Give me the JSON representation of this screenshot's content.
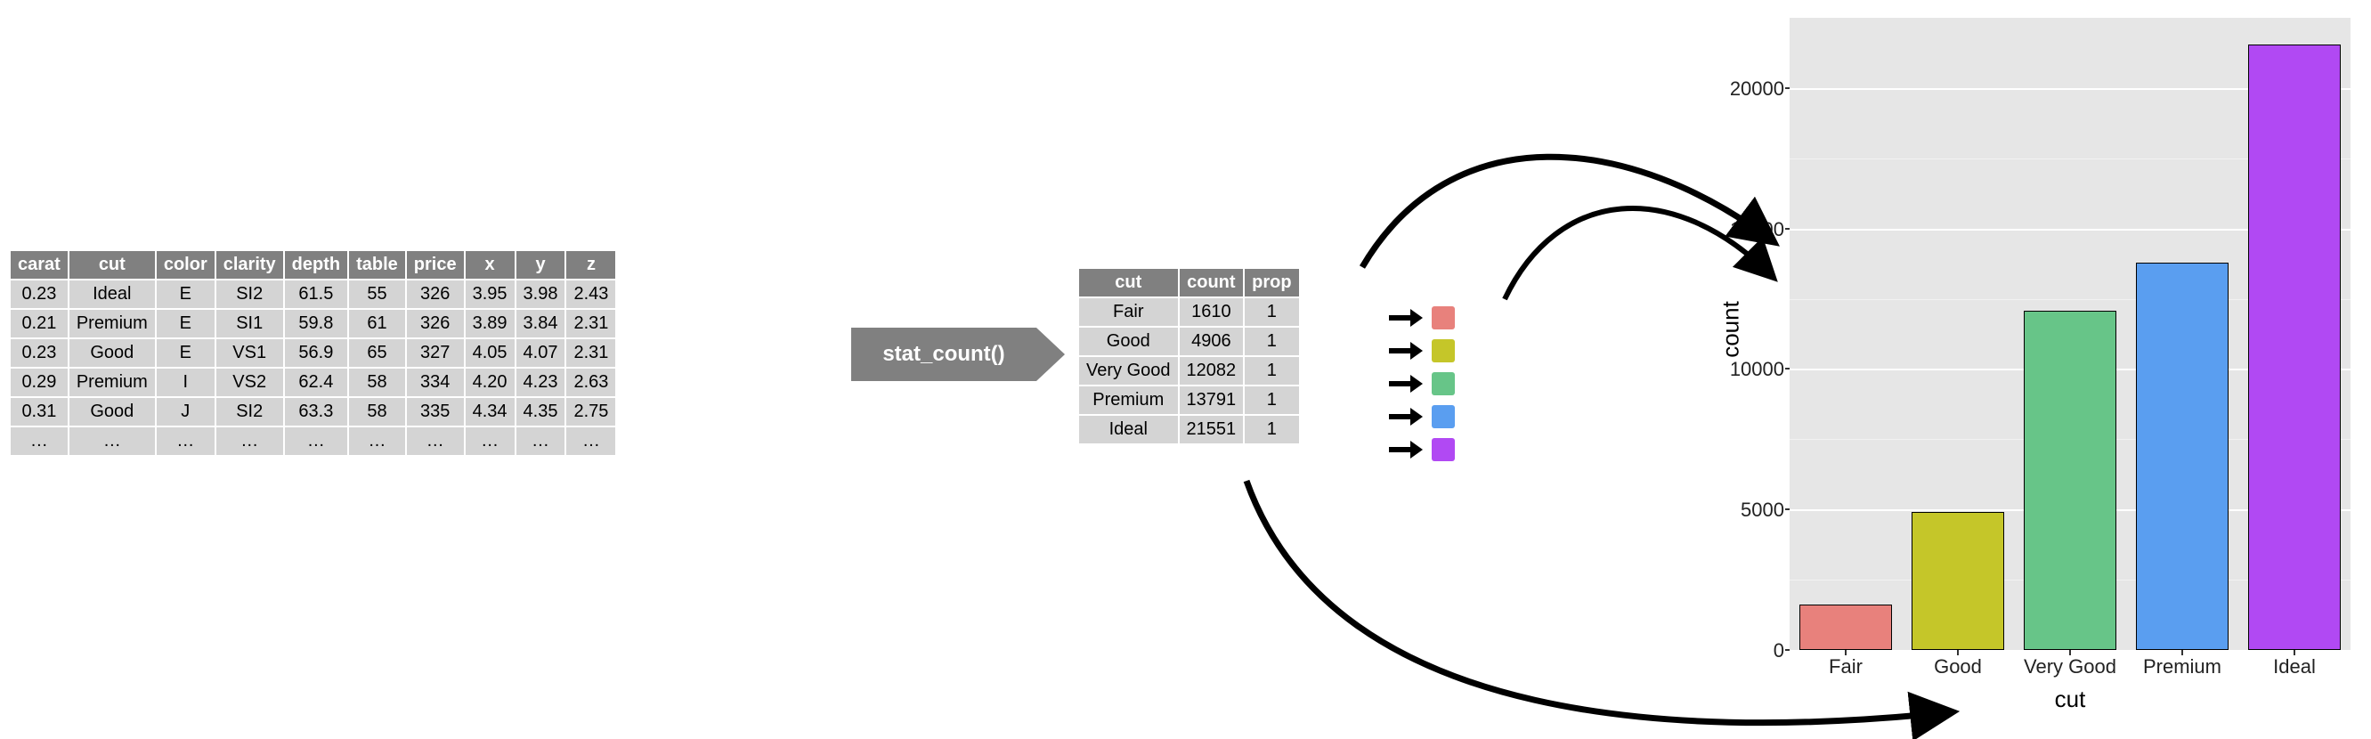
{
  "raw_table": {
    "headers": [
      "carat",
      "cut",
      "color",
      "clarity",
      "depth",
      "table",
      "price",
      "x",
      "y",
      "z"
    ],
    "rows": [
      [
        "0.23",
        "Ideal",
        "E",
        "SI2",
        "61.5",
        "55",
        "326",
        "3.95",
        "3.98",
        "2.43"
      ],
      [
        "0.21",
        "Premium",
        "E",
        "SI1",
        "59.8",
        "61",
        "326",
        "3.89",
        "3.84",
        "2.31"
      ],
      [
        "0.23",
        "Good",
        "E",
        "VS1",
        "56.9",
        "65",
        "327",
        "4.05",
        "4.07",
        "2.31"
      ],
      [
        "0.29",
        "Premium",
        "I",
        "VS2",
        "62.4",
        "58",
        "334",
        "4.20",
        "4.23",
        "2.63"
      ],
      [
        "0.31",
        "Good",
        "J",
        "SI2",
        "63.3",
        "58",
        "335",
        "4.34",
        "4.35",
        "2.75"
      ],
      [
        "…",
        "…",
        "…",
        "…",
        "…",
        "…",
        "…",
        "…",
        "…",
        "…"
      ]
    ]
  },
  "transform_label": "stat_count()",
  "agg_table": {
    "headers": [
      "cut",
      "count",
      "prop"
    ],
    "rows": [
      {
        "cut": "Fair",
        "count": 1610,
        "prop": 1,
        "color": "#e8817c"
      },
      {
        "cut": "Good",
        "count": 4906,
        "prop": 1,
        "color": "#c5c629"
      },
      {
        "cut": "Very Good",
        "count": 12082,
        "prop": 1,
        "color": "#67c588"
      },
      {
        "cut": "Premium",
        "count": 13791,
        "prop": 1,
        "color": "#5a9ef0"
      },
      {
        "cut": "Ideal",
        "count": 21551,
        "prop": 1,
        "color": "#b149f3"
      }
    ]
  },
  "chart_data": {
    "type": "bar",
    "categories": [
      "Fair",
      "Good",
      "Very Good",
      "Premium",
      "Ideal"
    ],
    "values": [
      1610,
      4906,
      12082,
      13791,
      21551
    ],
    "colors": [
      "#e8817c",
      "#c5c629",
      "#67c588",
      "#5a9ef0",
      "#b149f3"
    ],
    "title": "",
    "xlabel": "cut",
    "ylabel": "count",
    "ylim": [
      0,
      22500
    ],
    "y_ticks": [
      0,
      5000,
      10000,
      15000,
      20000
    ],
    "y_minor_ticks": [
      2500,
      7500,
      12500,
      17500
    ]
  }
}
